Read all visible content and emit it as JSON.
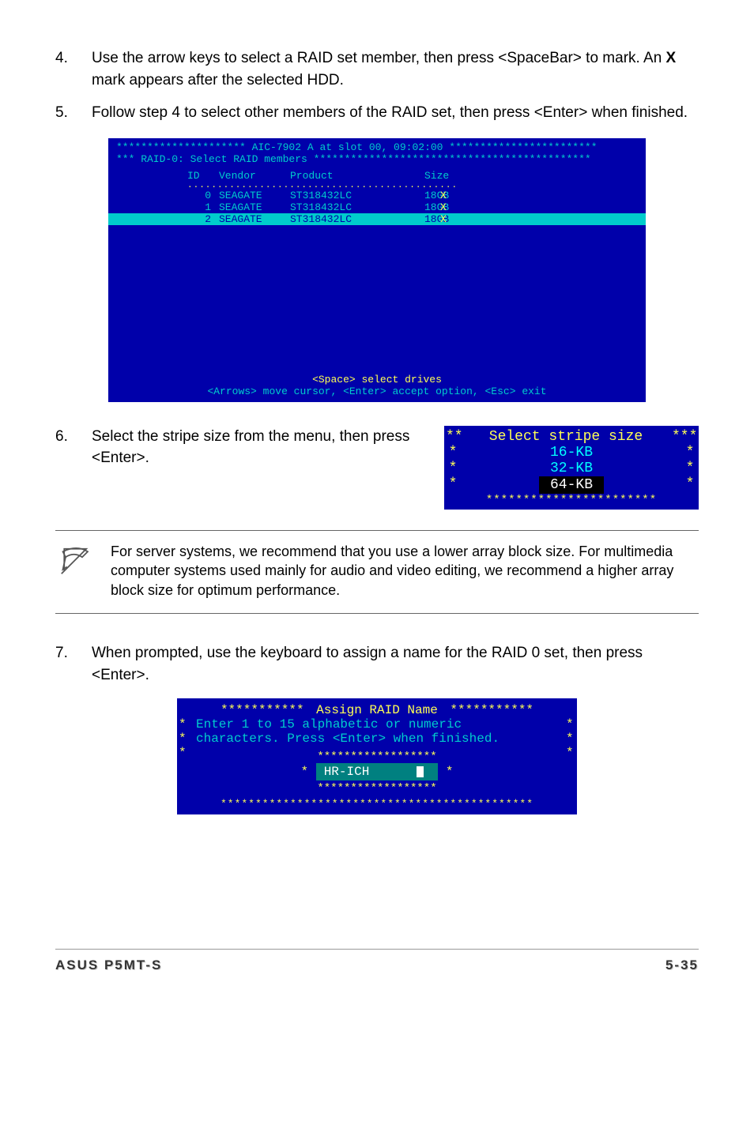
{
  "step4": {
    "num": "4.",
    "text_pre": "Use the arrow keys to select a RAID set member, then press <SpaceBar> to mark. An ",
    "bold": "X",
    "text_post": " mark appears after the selected HDD."
  },
  "step5": {
    "num": "5.",
    "text": "Follow step 4 to select other members of the RAID set, then press <Enter> when finished."
  },
  "terminal1": {
    "header_line": "********************* AIC-7902 A at slot 00, 09:02:00 ************************",
    "subtitle": "*** RAID-0: Select RAID members *********************************************",
    "th_id": "ID",
    "th_vendor": "Vendor",
    "th_product": "Product",
    "th_size": "Size",
    "dotted": ".............................................",
    "rows": [
      {
        "id": "0",
        "vendor": "SEAGATE",
        "product": "ST318432LC",
        "size": "18GB",
        "mark": "X"
      },
      {
        "id": "1",
        "vendor": "SEAGATE",
        "product": "ST318432LC",
        "size": "18GB",
        "mark": "X"
      },
      {
        "id": "2",
        "vendor": "SEAGATE",
        "product": "ST318432LC",
        "size": "18GB",
        "mark": "X"
      }
    ],
    "footer1": "<Space> select drives",
    "footer2": "<Arrows> move cursor, <Enter> accept option, <Esc> exit"
  },
  "step6": {
    "num": "6.",
    "text": "Select the stripe size from the menu, then press <Enter>."
  },
  "terminal2": {
    "title_left": "**",
    "title": "Select stripe size",
    "title_right": "***",
    "opt1": "16-KB",
    "opt2": "32-KB",
    "opt3": "64-KB",
    "stars": "***********************"
  },
  "note": {
    "text": "For server systems, we recommend that you use a lower array block size. For multimedia computer systems used mainly for audio and video editing, we recommend a higher array block size for optimum performance."
  },
  "step7": {
    "num": "7.",
    "text": "When prompted, use the keyboard to assign a name for the RAID 0 set, then press <Enter>."
  },
  "terminal3": {
    "header_stars_l": "***********",
    "header_title": " Assign RAID Name ",
    "header_stars_r": "***********",
    "line1": "Enter 1 to 15 alphabetic or numeric",
    "line2": "characters. Press <Enter> when finished.",
    "input_border": "******************",
    "input_marker": "*",
    "input_value": "HR-ICH",
    "footer_stars": "*********************************************"
  },
  "footer": {
    "left": "ASUS P5MT-S",
    "right": "5-35"
  }
}
